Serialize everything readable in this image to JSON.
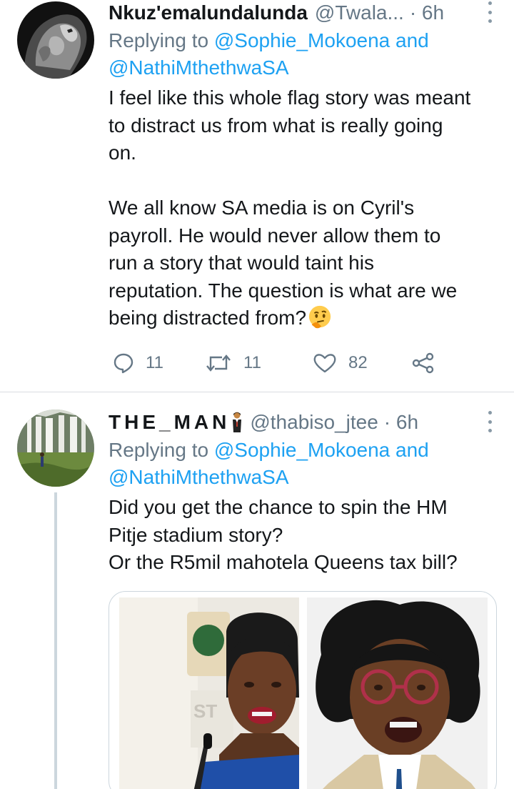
{
  "tweets": [
    {
      "display_name": "Nkuz'emalundalunda",
      "handle": "@Twala...",
      "time": "· 6h",
      "replying_prefix": "Replying to",
      "replying_user1": "@Sophie_Mokoena",
      "replying_and": "and",
      "replying_user2": "@NathiMthethwaSA",
      "body": "I feel like this whole flag story was meant\nto distract us from what is really going\non.\n\nWe all know SA media is on Cyril's\npayroll. He would never allow them to\nrun a story that would taint his\nreputation. The question is what are we\nbeing distracted from?",
      "emoji": "thinking-face-emoji",
      "actions": {
        "replies": "11",
        "retweets": "11",
        "likes": "82"
      }
    },
    {
      "display_name": "THE_MAN",
      "display_emoji": "man-in-suit-emoji",
      "handle": "@thabiso_jtee",
      "time": "· 6h",
      "replying_prefix": "Replying to",
      "replying_user1": "@Sophie_Mokoena",
      "replying_and": "and",
      "replying_user2": "@NathiMthethwaSA",
      "body": "Did you get the chance to spin the HM\nPitje stadium story?\nOr the R5mil mahotela Queens tax bill?",
      "media": [
        "photo-woman-speaking-at-podium",
        "photo-woman-with-glasses-speaking"
      ]
    }
  ],
  "colors": {
    "link": "#1da1f2",
    "secondary_text": "#657786",
    "primary_text": "#14171a",
    "divider": "#d9dde1"
  }
}
